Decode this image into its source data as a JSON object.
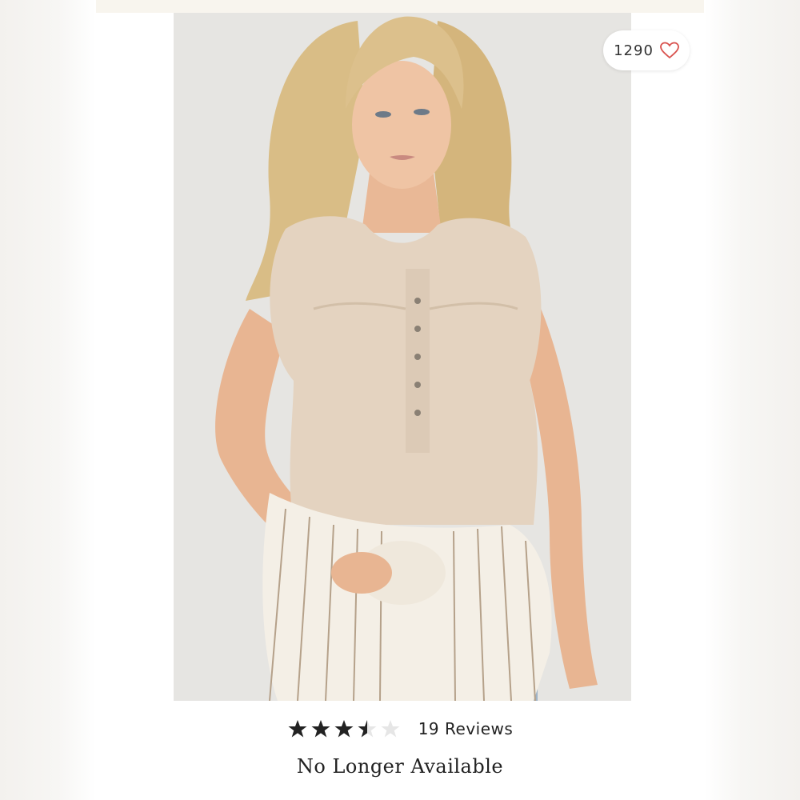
{
  "listing": {
    "like_count": "1290",
    "heart_icon": "heart-outline-icon",
    "accent_color": "#d9534f"
  },
  "product": {
    "image_icon": "product-photo",
    "rating": 3.5,
    "rating_max": 5,
    "reviews_label": "19 Reviews",
    "availability": "No Longer Available"
  }
}
